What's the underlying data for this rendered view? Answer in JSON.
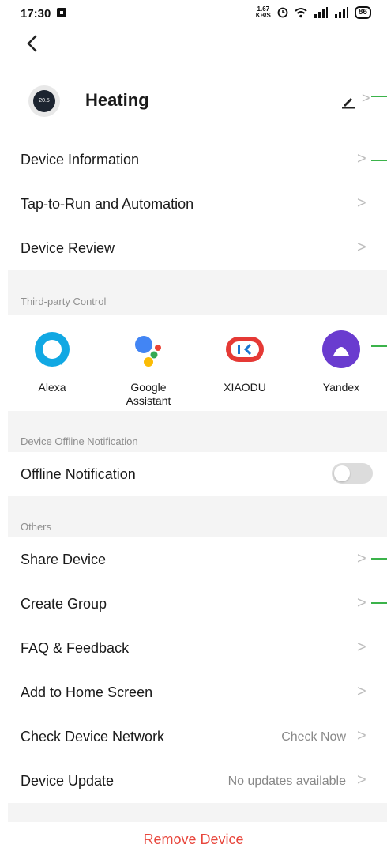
{
  "status_bar": {
    "time": "17:30",
    "speed_top": "1.67",
    "speed_bottom": "KB/S",
    "battery": "86"
  },
  "header": {
    "device_name": "Heating",
    "thermostat_reading": "20.5"
  },
  "menu_top": [
    {
      "label": "Device Information"
    },
    {
      "label": "Tap-to-Run and Automation"
    },
    {
      "label": "Device Review"
    }
  ],
  "third_party": {
    "title": "Third-party Control",
    "items": [
      {
        "label": "Alexa",
        "icon": "alexa-icon"
      },
      {
        "label": "Google\nAssistant",
        "icon": "google-assistant-icon"
      },
      {
        "label": "XIAODU",
        "icon": "xiaodu-icon"
      },
      {
        "label": "Yandex",
        "icon": "yandex-icon"
      }
    ]
  },
  "offline": {
    "title": "Device Offline Notification",
    "label": "Offline Notification",
    "enabled": false
  },
  "others": {
    "title": "Others",
    "items": [
      {
        "label": "Share Device",
        "value": ""
      },
      {
        "label": "Create Group",
        "value": ""
      },
      {
        "label": "FAQ & Feedback",
        "value": ""
      },
      {
        "label": "Add to Home Screen",
        "value": ""
      },
      {
        "label": "Check Device Network",
        "value": "Check Now"
      },
      {
        "label": "Device Update",
        "value": "No updates available"
      }
    ]
  },
  "remove_label": "Remove Device",
  "colors": {
    "accent_red": "#e8463c",
    "marker_green": "#3bb34a"
  }
}
